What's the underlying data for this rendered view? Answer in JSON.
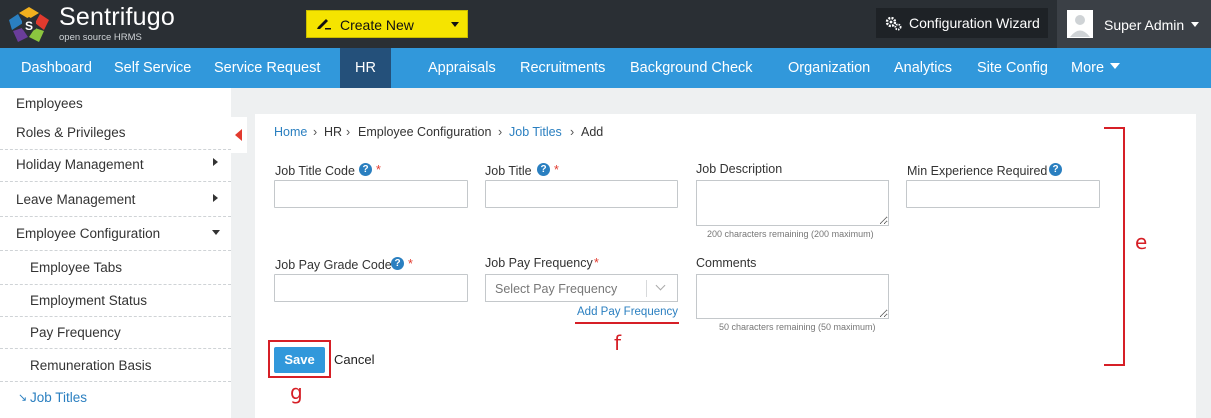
{
  "brand": {
    "name": "Sentrifugo",
    "tagline": "open source HRMS"
  },
  "header": {
    "create_new": "Create New",
    "config_wizard": "Configuration Wizard",
    "user": "Super Admin"
  },
  "nav": {
    "items": [
      "Dashboard",
      "Self Service",
      "Service Request",
      "HR",
      "Appraisals",
      "Recruitments",
      "Background Check",
      "Organization",
      "Analytics",
      "Site Config",
      "More"
    ],
    "active": "HR"
  },
  "sidebar": {
    "items": [
      "Employees",
      "Roles & Privileges",
      "Holiday Management",
      "Leave Management",
      "Employee Configuration",
      "Employee Tabs",
      "Employment Status",
      "Pay Frequency",
      "Remuneration Basis",
      "Job Titles"
    ],
    "active": "Job Titles"
  },
  "breadcrumb": [
    "Home",
    "HR",
    "Employee Configuration",
    "Job Titles",
    "Add"
  ],
  "form": {
    "job_title_code": {
      "label": "Job Title Code",
      "required": "*",
      "value": ""
    },
    "job_title": {
      "label": "Job Title",
      "required": "*",
      "value": ""
    },
    "job_description": {
      "label": "Job Description",
      "hint": "200 characters remaining (200 maximum)"
    },
    "min_experience": {
      "label": "Min Experience Required",
      "value": ""
    },
    "job_pay_grade_code": {
      "label": "Job Pay Grade Code",
      "required": "*",
      "value": ""
    },
    "job_pay_frequency": {
      "label": "Job Pay Frequency",
      "required": "*",
      "placeholder": "Select Pay Frequency",
      "add_link": "Add Pay Frequency"
    },
    "comments": {
      "label": "Comments",
      "hint": "50 characters remaining (50 maximum)"
    },
    "save": "Save",
    "cancel": "Cancel"
  },
  "annotations": {
    "e": "e",
    "f": "f",
    "g": "g"
  },
  "colors": {
    "topbar": "#2a2f34",
    "nav": "#3198db",
    "nav_active": "#24507a",
    "create_new": "#f5e400",
    "link": "#2a7fc0",
    "annotation": "#d61f26"
  }
}
